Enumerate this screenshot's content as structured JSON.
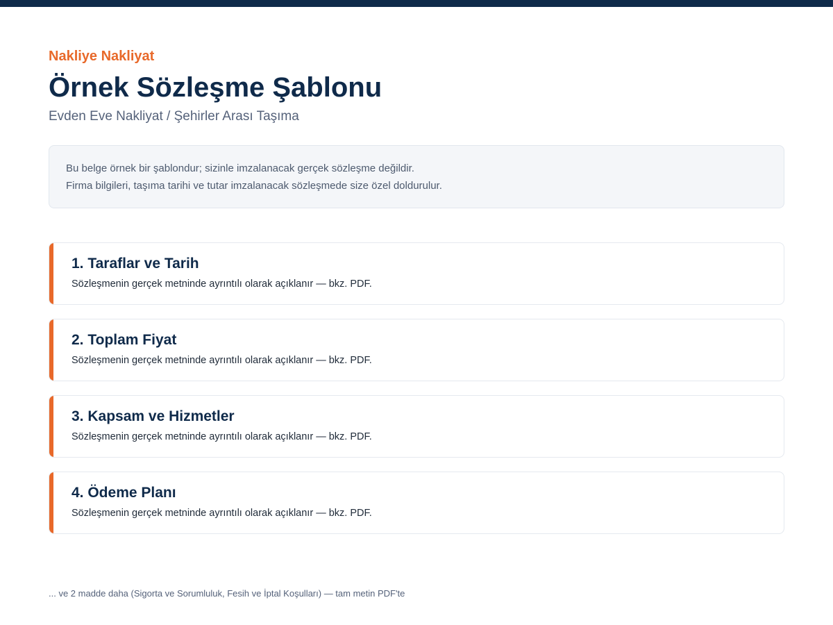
{
  "header": {
    "brand": "Nakliye Nakliyat",
    "title": "Örnek Sözleşme Şablonu",
    "subtitle": "Evden Eve Nakliyat / Şehirler Arası Taşıma"
  },
  "notice": {
    "line1": "Bu belge örnek bir şablondur; sizinle imzalanacak gerçek sözleşme değildir.",
    "line2": "Firma bilgileri, taşıma tarihi ve tutar imzalanacak sözleşmede size özel doldurulur."
  },
  "sections": [
    {
      "title": "1. Taraflar ve Tarih",
      "body": "Sözleşmenin gerçek metninde ayrıntılı olarak açıklanır — bkz. PDF."
    },
    {
      "title": "2. Toplam Fiyat",
      "body": "Sözleşmenin gerçek metninde ayrıntılı olarak açıklanır — bkz. PDF."
    },
    {
      "title": "3. Kapsam ve Hizmetler",
      "body": "Sözleşmenin gerçek metninde ayrıntılı olarak açıklanır — bkz. PDF."
    },
    {
      "title": "4. Ödeme Planı",
      "body": "Sözleşmenin gerçek metninde ayrıntılı olarak açıklanır — bkz. PDF."
    }
  ],
  "footer": {
    "note": "... ve 2 madde daha (Sigorta ve Sorumluluk, Fesih ve İptal Koşulları) — tam metin PDF'te"
  },
  "colors": {
    "navy": "#0f2a4a",
    "accent": "#e8692a",
    "notice_bg": "#f4f6f9"
  }
}
